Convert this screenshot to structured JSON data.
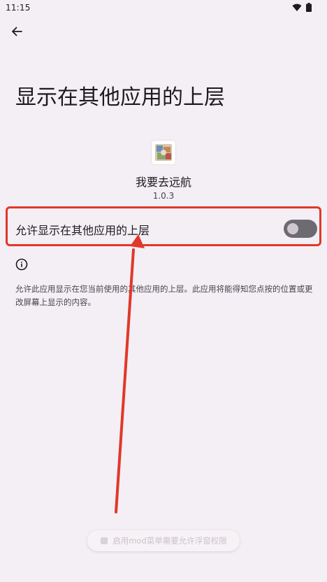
{
  "status_bar": {
    "time": "11:15",
    "icons": [
      "wifi-icon",
      "battery-icon"
    ]
  },
  "header": {
    "back_icon": "arrow-left-icon"
  },
  "page": {
    "title": "显示在其他应用的上层"
  },
  "app": {
    "name": "我要去远航",
    "version": "1.0.3"
  },
  "permission": {
    "label": "允许显示在其他应用的上层",
    "enabled": false
  },
  "info": {
    "icon": "info-icon",
    "description": "允许此应用显示在您当前使用的其他应用的上层。此应用将能得知您点按的位置或更改屏幕上显示的内容。"
  },
  "toast": {
    "text": "启用mod菜单需要允许浮窗权限"
  },
  "colors": {
    "background": "#f4eff4",
    "highlight": "#e0382a",
    "switch_track_off": "#6e6a72"
  }
}
